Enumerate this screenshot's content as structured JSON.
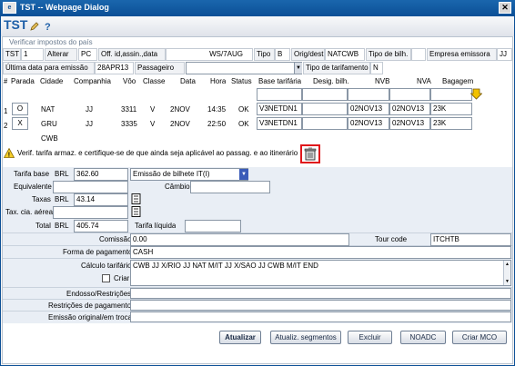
{
  "window": {
    "title": "TST -- Webpage Dialog",
    "heading": "TST"
  },
  "info": {
    "verify_taxes": "Verificar impostos do país"
  },
  "row1": {
    "tst_label": "TST",
    "tst_value": "1",
    "alterar": "Alterar",
    "pc": "PC",
    "off_label": "Off. id,assin.,data",
    "off_value": "WS/7AUG",
    "tipo_label": "Tipo",
    "tipo_value": "B",
    "origdest_label": "Orig/dest",
    "origdest_value": "NATCWB",
    "tipobilh_label": "Tipo de bilh.",
    "empresa_label": "Empresa emissora",
    "empresa_value": "JJ"
  },
  "row2": {
    "ultima_label": "Última data para emissão",
    "ultima_value": "28APR13",
    "passageiro_label": "Passageiro",
    "passageiro_value": "",
    "tipotarif_label": "Tipo de tarifamento",
    "tipotarif_value": "N"
  },
  "segments": {
    "columns": [
      "#",
      "Parada",
      "Cidade",
      "Companhia",
      "Vôo",
      "Classe",
      "Data",
      "Hora",
      "Status",
      "Base tarifária",
      "Desig. bilh.",
      "NVB",
      "NVA",
      "Bagagem"
    ],
    "rows": [
      {
        "num": "1",
        "parada": "O",
        "cidade": "NAT",
        "companhia": "JJ",
        "voo": "3311",
        "classe": "V",
        "data": "2NOV",
        "hora": "14:35",
        "status": "OK",
        "base": "V3NETDN1",
        "desig": "",
        "nvb": "02NOV13",
        "nva": "02NOV13",
        "bagagem": "23K"
      },
      {
        "num": "2",
        "parada": "X",
        "cidade": "GRU",
        "companhia": "JJ",
        "voo": "3335",
        "classe": "V",
        "data": "2NOV",
        "hora": "22:50",
        "status": "OK",
        "base": "V3NETDN1",
        "desig": "",
        "nvb": "02NOV13",
        "nva": "02NOV13",
        "bagagem": "23K"
      }
    ],
    "final_city": "CWB"
  },
  "warning": "Verif. tarifa armaz. e certifique-se de que ainda seja aplicável ao passag. e ao itinerário",
  "fare": {
    "tarifa_base_label": "Tarifa base",
    "tarifa_base_cur": "BRL",
    "tarifa_base_value": "362.60",
    "emissao_select": "Emissão de bilhete IT(I)",
    "equivalente_label": "Equivalente",
    "cambio_label": "Câmbio",
    "taxas_label": "Taxas",
    "taxas_cur": "BRL",
    "taxas_value": "43.14",
    "taxcia_label": "Tax. cia. aérea",
    "total_label": "Total",
    "total_cur": "BRL",
    "total_value": "405.74",
    "tarifa_liquida_label": "Tarifa líquida",
    "comissao_label": "Comissão",
    "comissao_value": "0.00",
    "tour_code_label": "Tour code",
    "tour_code_value": "ITCHTB",
    "forma_label": "Forma de pagamento",
    "forma_value": "CASH",
    "calculo_label": "Cálculo tarifário",
    "calculo_value": "CWB JJ X/RIO JJ NAT M/IT JJ X/SAO JJ CWB M/IT END",
    "criar_label": "Criar",
    "endosso_label": "Endosso/Restrições",
    "restricoes_label": "Restrições de pagamento",
    "emissao_original_label": "Emissão original/em troca"
  },
  "buttons": {
    "atualizar": "Atualizar",
    "atualiz_segmentos": "Atualiz. segmentos",
    "excluir": "Excluir",
    "noadc": "NOADC",
    "criar_mco": "Criar MCO"
  },
  "colors": {
    "titlebar": "#0b4f96",
    "heading": "#1d5fa8",
    "accent_red": "#e0161b",
    "arrow_yellow": "#f2c200"
  },
  "icons": [
    "pencil-icon",
    "help-icon",
    "warning-icon",
    "trash-icon",
    "down-arrow-icon",
    "calculator-icon",
    "close-icon"
  ]
}
